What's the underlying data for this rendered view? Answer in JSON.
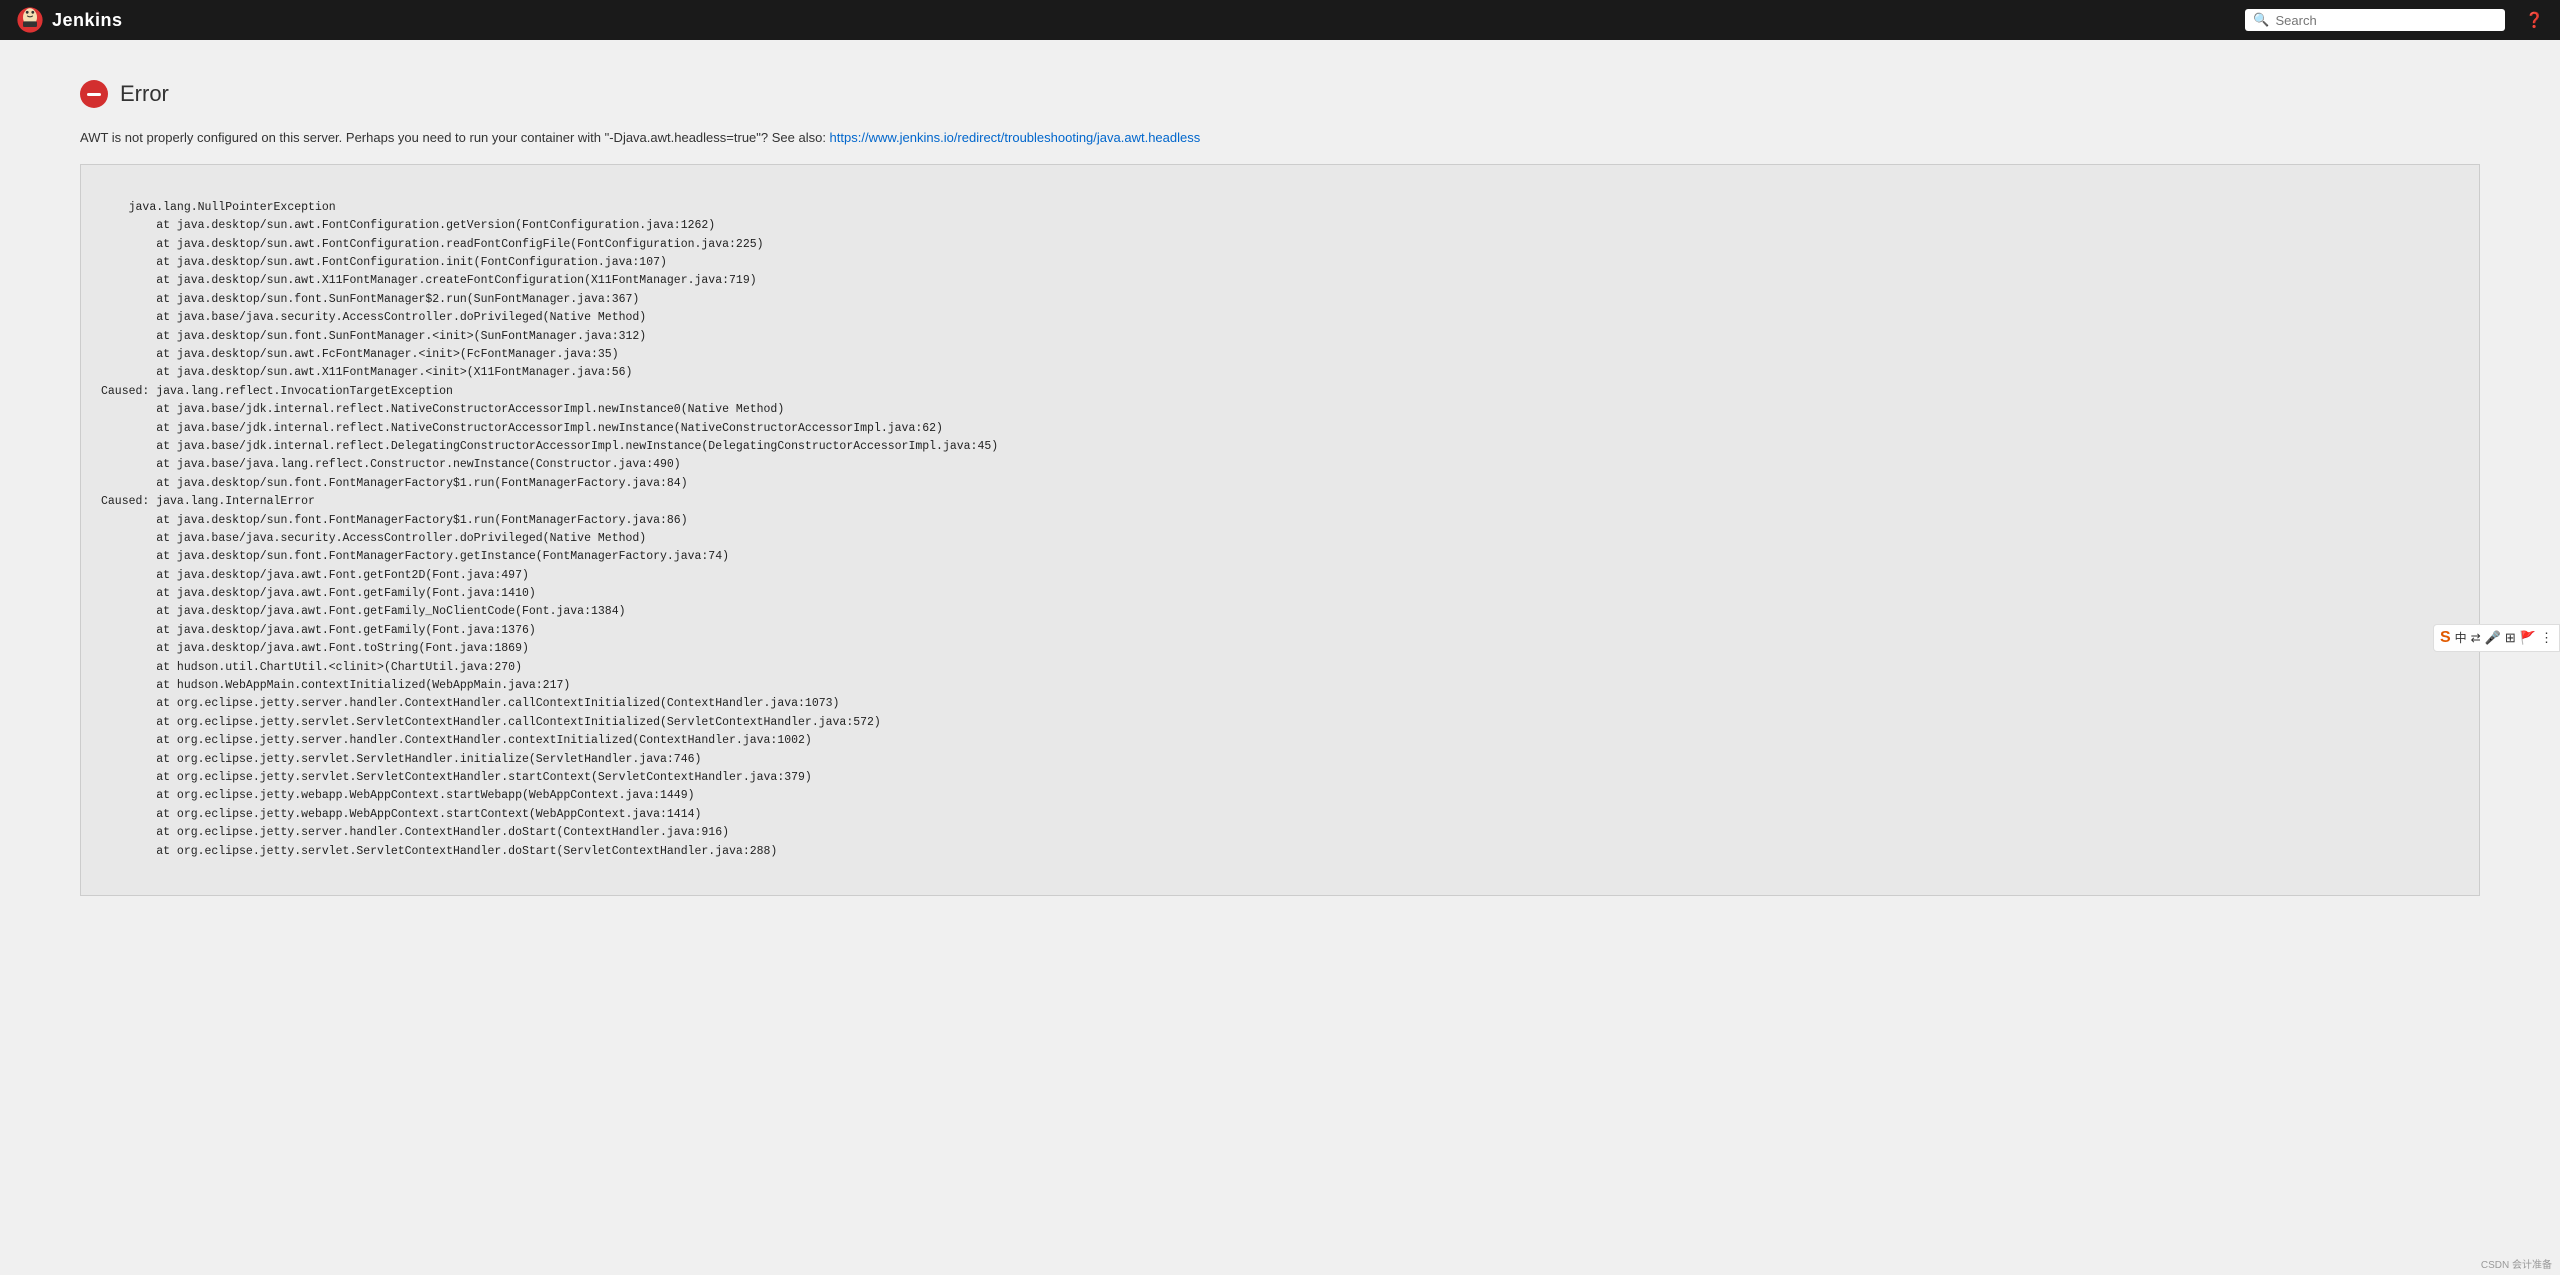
{
  "header": {
    "title": "Jenkins",
    "search_placeholder": "Search"
  },
  "error": {
    "title": "Error",
    "message": "AWT is not properly configured on this server. Perhaps you need to run your container with \"-Djava.awt.headless=true\"? See also: https://www.jenkins.io/redirect/troubleshooting/java.awt.headless",
    "link_text": "https://www.jenkins.io/redirect/troubleshooting/java.awt.headless"
  },
  "stack_trace": "java.lang.NullPointerException\n\tat java.desktop/sun.awt.FontConfiguration.getVersion(FontConfiguration.java:1262)\n\tat java.desktop/sun.awt.FontConfiguration.readFontConfigFile(FontConfiguration.java:225)\n\tat java.desktop/sun.awt.FontConfiguration.init(FontConfiguration.java:107)\n\tat java.desktop/sun.awt.X11FontManager.createFontConfiguration(X11FontManager.java:719)\n\tat java.desktop/sun.font.SunFontManager$2.run(SunFontManager.java:367)\n\tat java.base/java.security.AccessController.doPrivileged(Native Method)\n\tat java.desktop/sun.font.SunFontManager.<init>(SunFontManager.java:312)\n\tat java.desktop/sun.awt.FcFontManager.<init>(FcFontManager.java:35)\n\tat java.desktop/sun.awt.X11FontManager.<init>(X11FontManager.java:56)\nCaused: java.lang.reflect.InvocationTargetException\n\tat java.base/jdk.internal.reflect.NativeConstructorAccessorImpl.newInstance0(Native Method)\n\tat java.base/jdk.internal.reflect.NativeConstructorAccessorImpl.newInstance(NativeConstructorAccessorImpl.java:62)\n\tat java.base/jdk.internal.reflect.DelegatingConstructorAccessorImpl.newInstance(DelegatingConstructorAccessorImpl.java:45)\n\tat java.base/java.lang.reflect.Constructor.newInstance(Constructor.java:490)\n\tat java.desktop/sun.font.FontManagerFactory$1.run(FontManagerFactory.java:84)\nCaused: java.lang.InternalError\n\tat java.desktop/sun.font.FontManagerFactory$1.run(FontManagerFactory.java:86)\n\tat java.base/java.security.AccessController.doPrivileged(Native Method)\n\tat java.desktop/sun.font.FontManagerFactory.getInstance(FontManagerFactory.java:74)\n\tat java.desktop/java.awt.Font.getFont2D(Font.java:497)\n\tat java.desktop/java.awt.Font.getFamily(Font.java:1410)\n\tat java.desktop/java.awt.Font.getFamily_NoClientCode(Font.java:1384)\n\tat java.desktop/java.awt.Font.getFamily(Font.java:1376)\n\tat java.desktop/java.awt.Font.toString(Font.java:1869)\n\tat hudson.util.ChartUtil.<clinit>(ChartUtil.java:270)\n\tat hudson.WebAppMain.contextInitialized(WebAppMain.java:217)\n\tat org.eclipse.jetty.server.handler.ContextHandler.callContextInitialized(ContextHandler.java:1073)\n\tat org.eclipse.jetty.servlet.ServletContextHandler.callContextInitialized(ServletContextHandler.java:572)\n\tat org.eclipse.jetty.server.handler.ContextHandler.contextInitialized(ContextHandler.java:1002)\n\tat org.eclipse.jetty.servlet.ServletHandler.initialize(ServletHandler.java:746)\n\tat org.eclipse.jetty.servlet.ServletContextHandler.startContext(ServletContextHandler.java:379)\n\tat org.eclipse.jetty.webapp.WebAppContext.startWebapp(WebAppContext.java:1449)\n\tat org.eclipse.jetty.webapp.WebAppContext.startContext(WebAppContext.java:1414)\n\tat org.eclipse.jetty.server.handler.ContextHandler.doStart(ContextHandler.java:916)\n\tat org.eclipse.jetty.servlet.ServletContextHandler.doStart(ServletContextHandler.java:288)",
  "watermark": {
    "text": "CSDN 会计准备"
  }
}
